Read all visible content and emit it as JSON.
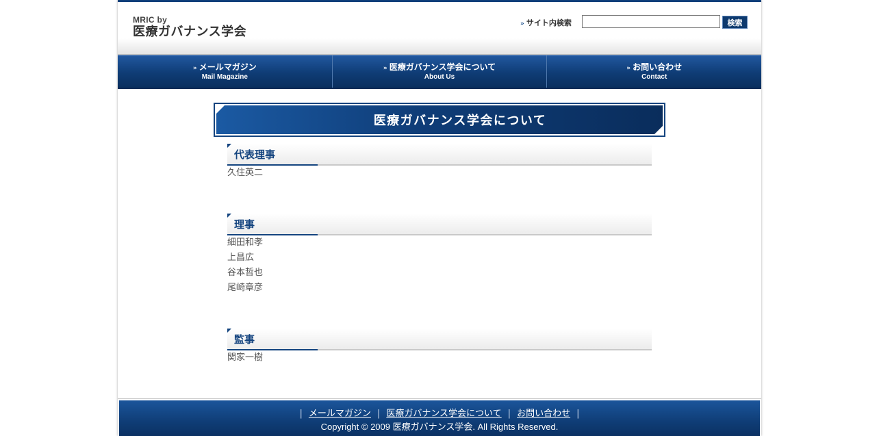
{
  "header": {
    "logo_sub": "MRIC by",
    "logo_main": "医療ガバナンス学会",
    "search_label": "サイト内検索",
    "search_value": "",
    "search_button": "検索"
  },
  "nav": [
    {
      "jp": "メールマガジン",
      "en": "Mail Magazine"
    },
    {
      "jp": "医療ガバナンス学会について",
      "en": "About Us"
    },
    {
      "jp": "お問い合わせ",
      "en": "Contact"
    }
  ],
  "page_title": "医療ガバナンス学会について",
  "sections": [
    {
      "title": "代表理事",
      "members": [
        "久住英二"
      ]
    },
    {
      "title": "理事",
      "members": [
        "細田和孝",
        "上昌広",
        "谷本哲也",
        "尾崎章彦"
      ]
    },
    {
      "title": "監事",
      "members": [
        "関家一樹"
      ]
    }
  ],
  "footer": {
    "links": [
      "メールマガジン",
      "医療ガバナンス学会について",
      "お問い合わせ"
    ],
    "copyright": "Copyright © 2009 医療ガバナンス学会. All Rights Reserved."
  },
  "colors": {
    "brand_blue": "#0f3d76",
    "accent_blue": "#14447f"
  }
}
